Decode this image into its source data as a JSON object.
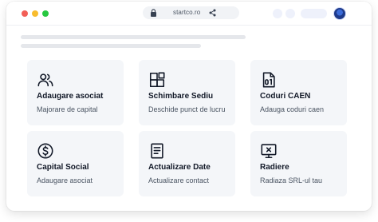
{
  "browser": {
    "url": "startco.ro",
    "icons": {
      "lock": "lock-icon",
      "share": "share-icon"
    }
  },
  "cards": [
    {
      "title": "Adaugare asociat",
      "subtitle": "Majorare de capital",
      "icon": "users-icon"
    },
    {
      "title": "Schimbare Sediu",
      "subtitle": "Deschide punct de lucru",
      "icon": "squares-icon"
    },
    {
      "title": "Coduri CAEN",
      "subtitle": "Adauga coduri caen",
      "icon": "binary-file-icon"
    },
    {
      "title": "Capital Social",
      "subtitle": "Adaugare asociat",
      "icon": "dollar-circle-icon"
    },
    {
      "title": "Actualizare Date",
      "subtitle": "Actualizare contact",
      "icon": "document-lines-icon"
    },
    {
      "title": "Radiere",
      "subtitle": "Radiaza SRL-ul tau",
      "icon": "monitor-x-icon"
    }
  ],
  "colors": {
    "accent_dark": "#111827",
    "card_bg": "#f4f6f9",
    "dot_red": "#f25f57",
    "dot_yellow": "#f8bc2e",
    "dot_green": "#27c840"
  }
}
